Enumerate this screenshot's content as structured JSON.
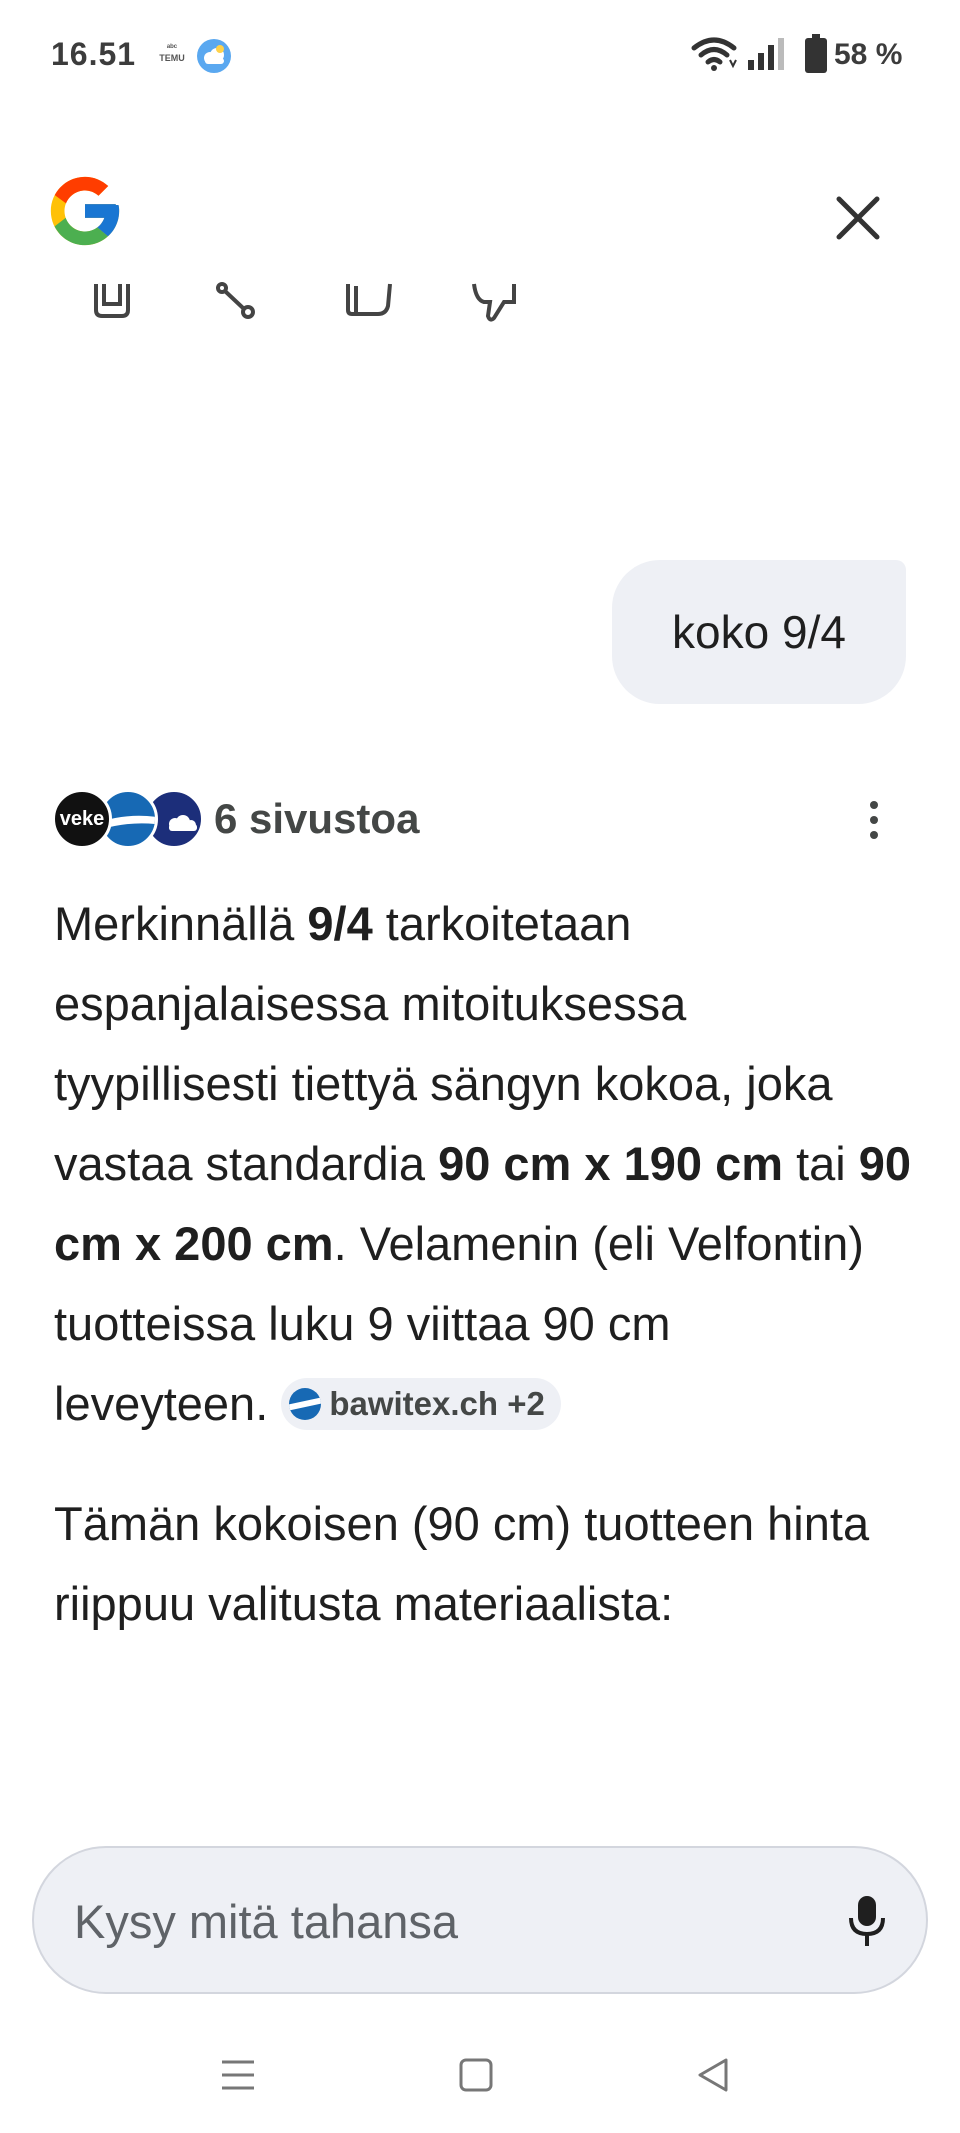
{
  "status_bar": {
    "time": "16.51",
    "notification_icons": [
      "temu-icon",
      "weather-icon"
    ],
    "temu_label": "TEMU",
    "battery_percent": "58 %",
    "system_icons": [
      "wifi-icon",
      "signal-icon",
      "battery-icon"
    ]
  },
  "header": {
    "logo": "google-logo",
    "close_icon": "close-icon"
  },
  "action_icons": [
    "copy-icon",
    "share-icon",
    "thumb-up-icon",
    "thumb-down-icon"
  ],
  "conversation": {
    "user_message": "koko 9/4",
    "sources": {
      "label": "6 sivustoa",
      "logo_text": "veke"
    },
    "answer_paragraph_1": {
      "t1": "Merkinnällä ",
      "b1": "9/4",
      "t2": " tarkoitetaan espanjalaisessa mitoituksessa tyypillisesti tiettyä sängyn kokoa, joka vastaa standardia ",
      "b2": "90 cm x 190 cm",
      "t3": " tai ",
      "b3": "90 cm x 200 cm",
      "t4": ". Velamenin (eli Velfontin) tuotteissa luku 9 viittaa 90 cm",
      "t5": "leveyteen. ",
      "citation": "bawitex.ch +2"
    },
    "answer_paragraph_2": "Tämän kokoisen (90 cm) tuotteen hinta riippuu valitusta materiaalista:"
  },
  "input_bar": {
    "placeholder": "Kysy mitä tahansa",
    "mic_icon": "microphone-icon"
  },
  "nav_bar": {
    "buttons": [
      "menu-icon",
      "home-icon",
      "back-icon"
    ]
  },
  "colors": {
    "bubble_bg": "#eef0f5",
    "text": "#1f1f1f",
    "muted": "#444746"
  }
}
